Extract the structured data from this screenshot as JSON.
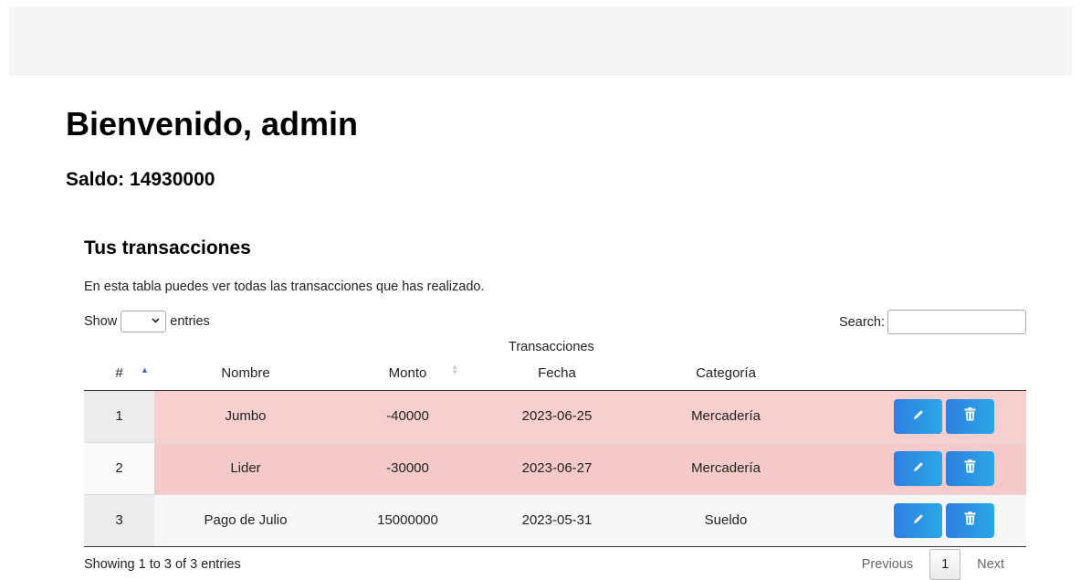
{
  "header": {
    "welcome": "Bienvenido, admin",
    "balance_label": "Saldo:",
    "balance_value": "14930000"
  },
  "transactions": {
    "title": "Tus transacciones",
    "description": "En esta tabla puedes ver todas las transacciones que has realizado.",
    "length_label_before": "Show",
    "length_label_after": "entries",
    "search_label": "Search:",
    "group_header": "Transacciones",
    "columns": {
      "index": "#",
      "name": "Nombre",
      "amount": "Monto",
      "date": "Fecha",
      "category": "Categoría"
    },
    "rows": [
      {
        "index": "1",
        "name": "Jumbo",
        "amount": "-40000",
        "date": "2023-06-25",
        "category": "Mercadería"
      },
      {
        "index": "2",
        "name": "Lider",
        "amount": "-30000",
        "date": "2023-06-27",
        "category": "Mercadería"
      },
      {
        "index": "3",
        "name": "Pago de Julio",
        "amount": "15000000",
        "date": "2023-05-31",
        "category": "Sueldo"
      }
    ],
    "info": "Showing 1 to 3 of 3 entries",
    "pagination": {
      "previous": "Previous",
      "current": "1",
      "next": "Next"
    }
  },
  "icons": {
    "edit": "pencil-icon",
    "delete": "trash-icon"
  },
  "colors": {
    "negative_row": "#f8cfcf",
    "action_button": "#2f7fe0",
    "sort_active": "#4b63c9"
  }
}
